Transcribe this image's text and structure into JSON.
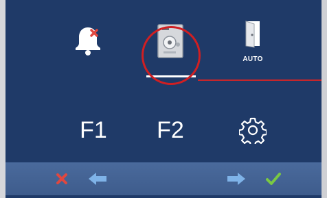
{
  "menu": {
    "items": [
      {
        "icon": "bell-muted-icon",
        "label": ""
      },
      {
        "icon": "intercom-panel-icon",
        "label": ""
      },
      {
        "icon": "door-icon",
        "label": "AUTO"
      }
    ],
    "selected_index": 1
  },
  "functions": {
    "f1_label": "F1",
    "f2_label": "F2",
    "settings_icon": "gear-icon"
  },
  "bottom_bar": {
    "cancel_icon": "cancel-icon",
    "prev_icon": "arrow-left-icon",
    "next_icon": "arrow-right-icon",
    "confirm_icon": "checkmark-icon"
  },
  "colors": {
    "screen_bg": "#1f3a68",
    "bar_bg": "#4a6a9c",
    "highlight": "#d01f22",
    "cancel": "#e0473f",
    "arrows": "#7fb3e8",
    "confirm": "#7ac943"
  }
}
